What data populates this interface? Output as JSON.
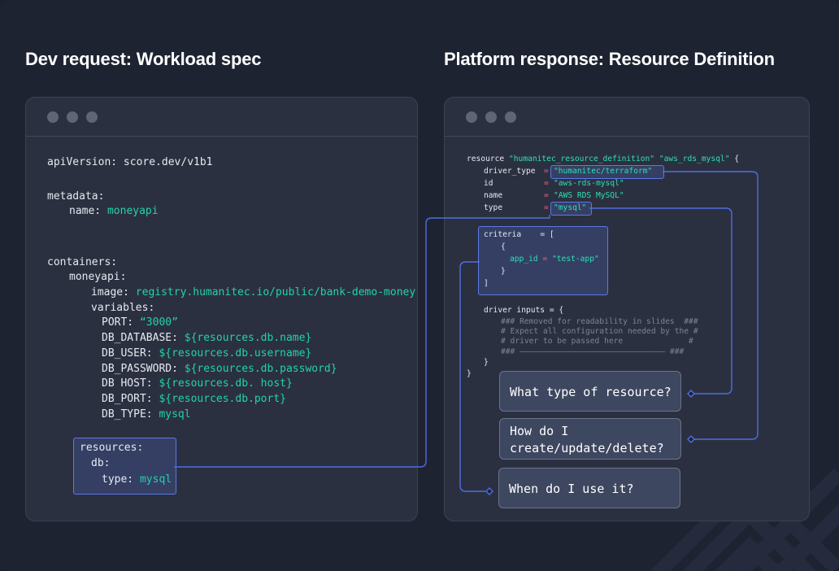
{
  "headings": {
    "left": "Dev request: Workload spec",
    "right": "Platform response: Resource Definition"
  },
  "workload_spec": {
    "api_version_key": "apiVersion:",
    "api_version_value": "score.dev/v1b1",
    "metadata_key": "metadata:",
    "name_key": "name:",
    "name_value": "moneyapi",
    "containers_key": "containers:",
    "container_name": "moneyapi:",
    "image_key": "image:",
    "image_value": "registry.humanitec.io/public/bank-demo-money",
    "variables_key": "variables:",
    "variables": [
      {
        "key": "PORT:",
        "value": "“3000”"
      },
      {
        "key": "DB_DATABASE:",
        "value": "${resources.db.name}"
      },
      {
        "key": "DB_USER:",
        "value": "${resources.db.username}"
      },
      {
        "key": "DB_PASSWORD:",
        "value": "${resources.db.password}"
      },
      {
        "key": "DB HOST:",
        "value": "${resources.db. host}"
      },
      {
        "key": "DB_PORT:",
        "value": "${resources.db.port}"
      },
      {
        "key": "DB_TYPE:",
        "value": "mysql"
      }
    ],
    "resources_key": "resources:",
    "db_key": "db:",
    "type_key": "type:",
    "type_value": "mysql"
  },
  "resource_definition": {
    "resource_kw": "resource",
    "resource_type": "\"humanitec_resource_definition\"",
    "resource_name": "\"aws_rds_mysql\"",
    "open_brace": "{",
    "fields": [
      {
        "key": "driver_type",
        "eq": "=",
        "value": "\"humanitec/terraform\""
      },
      {
        "key": "id",
        "eq": "=",
        "value": "\"aws-rds-mysql\""
      },
      {
        "key": "name",
        "eq": "=",
        "value": "\"AWS RDS MySQL\""
      },
      {
        "key": "type",
        "eq": "=",
        "value": "\"mysql\""
      }
    ],
    "criteria_key": "criteria",
    "criteria_eq": "= [",
    "criteria_open": "{",
    "app_id_key": "app_id",
    "app_id_eq": "=",
    "app_id_value": "\"test-app\"",
    "criteria_close_brace": "}",
    "criteria_close_bracket": "]",
    "driver_inputs": "driver inputs = {",
    "comments": [
      "### Removed for readability in slides  ###",
      "# Expect all configuration needed by the #",
      "# driver to be passed here              #",
      "### ——————————————————————————————— ###"
    ],
    "close_inner": "}",
    "close_outer": "}"
  },
  "callouts": {
    "what_type": "What type of resource?",
    "how": "How do I\ncreate/update/delete?",
    "when": "When do I use it?"
  },
  "colors": {
    "background": "#1e2332",
    "panel": "#2b3040",
    "accent_line": "#5b78e6",
    "value_text": "#22d3a6"
  }
}
